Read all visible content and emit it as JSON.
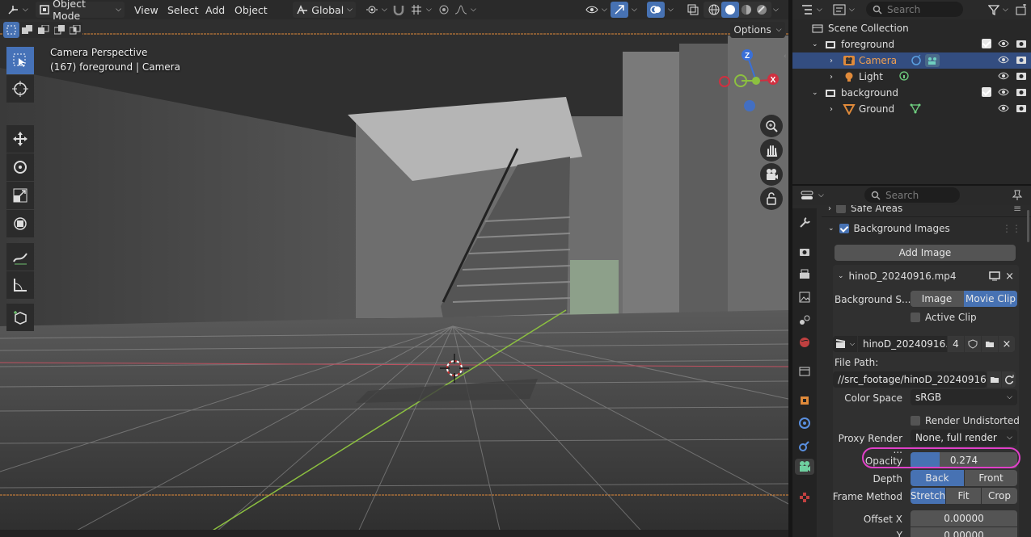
{
  "header": {
    "mode": "Object Mode",
    "menus": [
      "View",
      "Select",
      "Add",
      "Object"
    ],
    "transform_orientation": "Global"
  },
  "viewport": {
    "options_label": "Options",
    "overlay_title": "Camera Perspective",
    "overlay_subtitle": "(167) foreground | Camera",
    "gizmo": {
      "z": "Z",
      "x": "X"
    }
  },
  "outliner": {
    "search_placeholder": "Search",
    "root": "Scene Collection",
    "items": [
      {
        "label": "foreground",
        "type": "collection"
      },
      {
        "label": "Camera",
        "type": "camera",
        "selected": true
      },
      {
        "label": "Light",
        "type": "light"
      },
      {
        "label": "background",
        "type": "collection"
      },
      {
        "label": "Ground",
        "type": "mesh"
      }
    ]
  },
  "properties": {
    "search_placeholder": "Search",
    "safe_areas": "Safe Areas",
    "bg_images": "Background Images",
    "add_image": "Add Image",
    "clip_panel_title": "hinoD_20240916.mp4",
    "bg_source_label": "Background S...",
    "bg_source_image": "Image",
    "bg_source_movie": "Movie Clip",
    "active_clip": "Active Clip",
    "clip_name": "hinoD_20240916...",
    "clip_users": "4",
    "file_path_label": "File Path:",
    "file_path": "//src_footage/hinoD_20240916...",
    "color_space_label": "Color Space",
    "color_space": "sRGB",
    "render_undistorted": "Render Undistorted",
    "proxy_label": "Proxy Render ...",
    "proxy_value": "None, full render",
    "opacity_label": "Opacity",
    "opacity_value": "0.274",
    "opacity_fraction": 0.274,
    "depth_label": "Depth",
    "depth_back": "Back",
    "depth_front": "Front",
    "frame_method_label": "Frame Method",
    "fm_stretch": "Stretch",
    "fm_fit": "Fit",
    "fm_crop": "Crop",
    "offset_x_label": "Offset X",
    "offset_x": "0.00000",
    "offset_y_label": "Y",
    "offset_y": "0.00000"
  },
  "colors": {
    "accent": "#4772b3",
    "selection": "#334d80",
    "highlight_ring": "#e040c8",
    "axis_x": "#d03040",
    "axis_y": "#8cc040",
    "axis_z": "#3a70d8"
  }
}
